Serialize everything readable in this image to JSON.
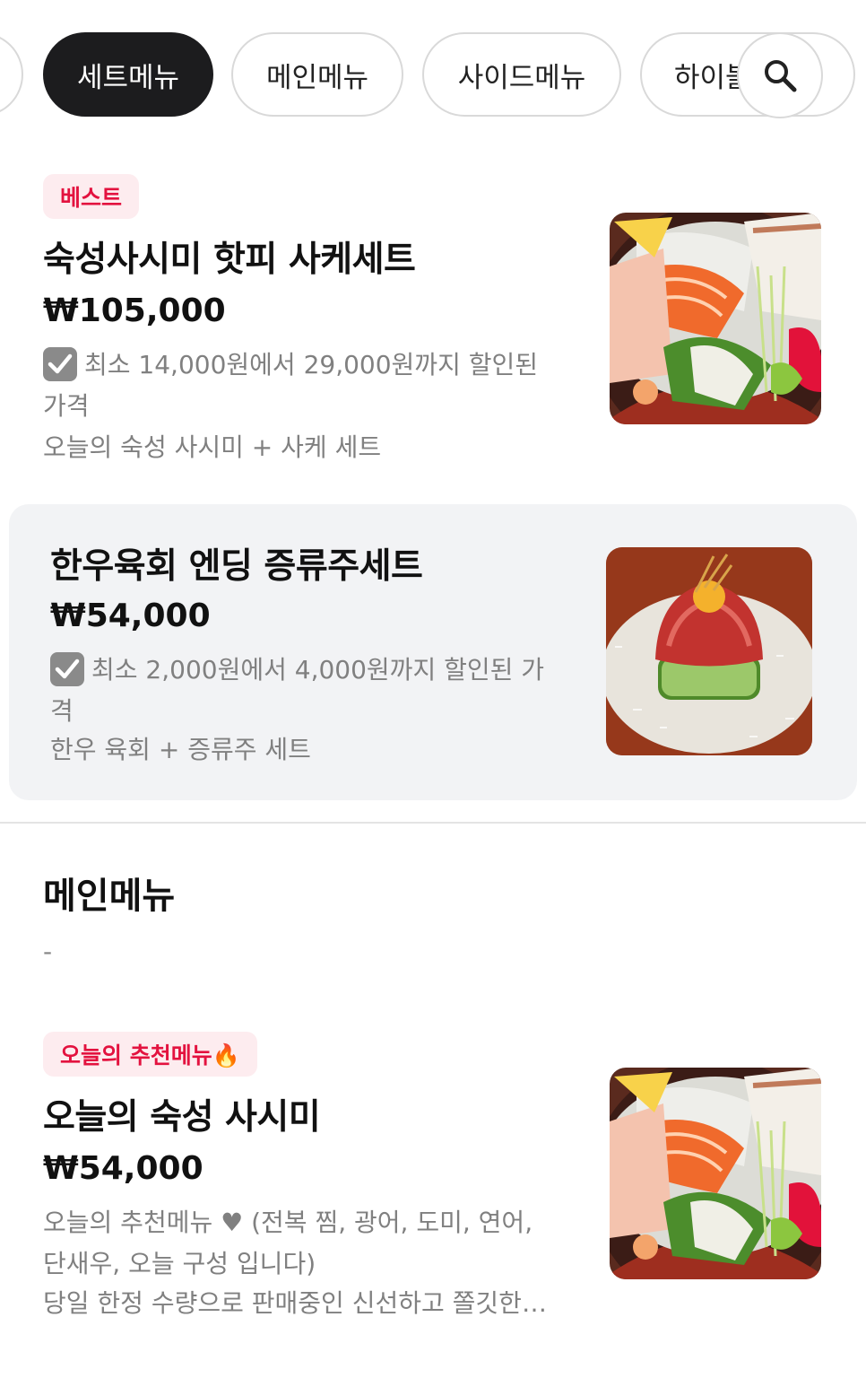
{
  "tabs": {
    "items": [
      {
        "label": ""
      },
      {
        "label": "세트메뉴",
        "active": true
      },
      {
        "label": "메인메뉴"
      },
      {
        "label": "사이드메뉴"
      },
      {
        "label": "하이볼"
      }
    ],
    "search_icon": "search-icon"
  },
  "set_items": [
    {
      "badge": "베스트",
      "title": "숙성사시미 핫피 사케세트",
      "price": "₩105,000",
      "discount": "최소 14,000원에서 29,000원까지 할인된 가격",
      "description": "오늘의 숙성 사시미 + 사케 세트",
      "image": "sashimi-platter"
    },
    {
      "title": "한우육회 엔딩 증류주세트",
      "price": "₩54,000",
      "discount": "최소 2,000원에서 4,000원까지 할인된 가격",
      "description": "한우 육회 + 증류주 세트",
      "image": "hanwoo-yukhoe"
    }
  ],
  "main_section": {
    "title": "메인메뉴",
    "subtitle": "-",
    "items": [
      {
        "badge": "오늘의 추천메뉴🔥",
        "title": "오늘의 숙성 사시미",
        "price": "₩54,000",
        "description_1": "오늘의 추천메뉴 ♥ (전복 찜, 광어, 도미, 연어, 단새우,  오늘 구성 입니다)",
        "description_2": "당일 한정 수량으로 판매중인 신선하고 쫄깃한 숙성 사시미",
        "image": "sashimi-platter"
      }
    ]
  },
  "colors": {
    "active_tab": "#1c1c1e",
    "badge_text": "#e3123f",
    "badge_bg": "#fdecef",
    "highlight_bg": "#f2f3f5",
    "muted_text": "#808080"
  }
}
